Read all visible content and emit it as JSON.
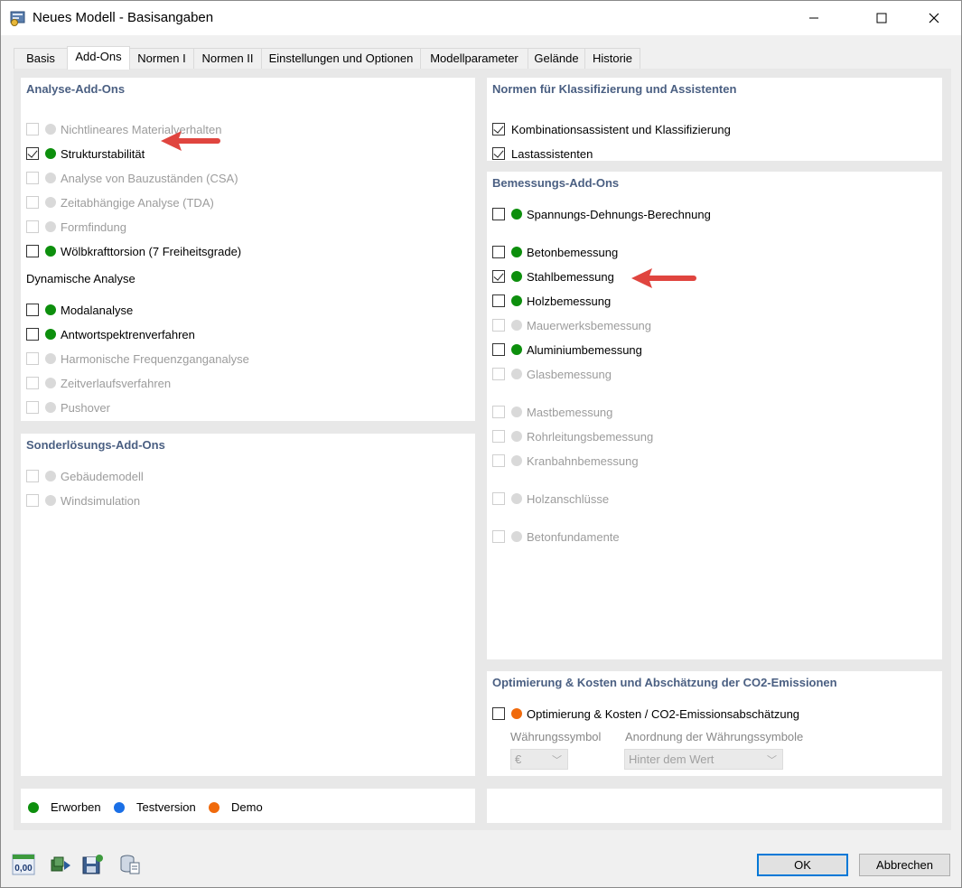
{
  "window": {
    "title": "Neues Modell - Basisangaben",
    "icons": [
      "app-icon",
      "minimize-icon",
      "maximize-icon",
      "close-icon"
    ]
  },
  "tabs": [
    {
      "label": "Basis"
    },
    {
      "label": "Add-Ons"
    },
    {
      "label": "Normen I"
    },
    {
      "label": "Normen II"
    },
    {
      "label": "Einstellungen und Optionen"
    },
    {
      "label": "Modellparameter"
    },
    {
      "label": "Gelände"
    },
    {
      "label": "Historie"
    }
  ],
  "active_tab": "Add-Ons",
  "analysis": {
    "title": "Analyse-Add-Ons",
    "items": [
      {
        "label": "Nichtlineares Materialverhalten",
        "checked": false,
        "enabled": false,
        "status": "none"
      },
      {
        "label": "Strukturstabilität",
        "checked": true,
        "enabled": true,
        "status": "erworben"
      },
      {
        "label": "Analyse von Bauzuständen (CSA)",
        "checked": false,
        "enabled": false,
        "status": "none"
      },
      {
        "label": "Zeitabhängige Analyse (TDA)",
        "checked": false,
        "enabled": false,
        "status": "none"
      },
      {
        "label": "Formfindung",
        "checked": false,
        "enabled": false,
        "status": "none"
      },
      {
        "label": "Wölbkrafttorsion (7 Freiheitsgrade)",
        "checked": false,
        "enabled": true,
        "status": "erworben"
      }
    ],
    "dynamic_label": "Dynamische Analyse",
    "dynamic_items": [
      {
        "label": "Modalanalyse",
        "checked": false,
        "enabled": true,
        "status": "erworben"
      },
      {
        "label": "Antwortspektrenverfahren",
        "checked": false,
        "enabled": true,
        "status": "erworben"
      },
      {
        "label": "Harmonische Frequenzganganalyse",
        "checked": false,
        "enabled": false,
        "status": "none"
      },
      {
        "label": "Zeitverlaufsverfahren",
        "checked": false,
        "enabled": false,
        "status": "none"
      },
      {
        "label": "Pushover",
        "checked": false,
        "enabled": false,
        "status": "none"
      }
    ]
  },
  "special": {
    "title": "Sonderlösungs-Add-Ons",
    "items": [
      {
        "label": "Gebäudemodell",
        "checked": false,
        "enabled": false,
        "status": "none"
      },
      {
        "label": "Windsimulation",
        "checked": false,
        "enabled": false,
        "status": "none"
      }
    ]
  },
  "standards": {
    "title": "Normen für Klassifizierung und Assistenten",
    "items": [
      {
        "label": "Kombinationsassistent und Klassifizierung",
        "checked": true,
        "enabled": true
      },
      {
        "label": "Lastassistenten",
        "checked": true,
        "enabled": true
      }
    ]
  },
  "design": {
    "title": "Bemessungs-Add-Ons",
    "items": [
      {
        "label": "Spannungs-Dehnungs-Berechnung",
        "checked": false,
        "enabled": true,
        "status": "erworben"
      },
      {
        "label": "Betonbemessung",
        "checked": false,
        "enabled": true,
        "status": "erworben"
      },
      {
        "label": "Stahlbemessung",
        "checked": true,
        "enabled": true,
        "status": "erworben"
      },
      {
        "label": "Holzbemessung",
        "checked": false,
        "enabled": true,
        "status": "erworben"
      },
      {
        "label": "Mauerwerksbemessung",
        "checked": false,
        "enabled": false,
        "status": "none"
      },
      {
        "label": "Aluminiumbemessung",
        "checked": false,
        "enabled": true,
        "status": "erworben"
      },
      {
        "label": "Glasbemessung",
        "checked": false,
        "enabled": false,
        "status": "none"
      },
      {
        "label": "Mastbemessung",
        "checked": false,
        "enabled": false,
        "status": "none"
      },
      {
        "label": "Rohrleitungsbemessung",
        "checked": false,
        "enabled": false,
        "status": "none"
      },
      {
        "label": "Kranbahnbemessung",
        "checked": false,
        "enabled": false,
        "status": "none"
      },
      {
        "label": "Holzanschlüsse",
        "checked": false,
        "enabled": false,
        "status": "none"
      },
      {
        "label": "Betonfundamente",
        "checked": false,
        "enabled": false,
        "status": "none"
      }
    ]
  },
  "optimization": {
    "title": "Optimierung & Kosten und Abschätzung der CO2-Emissionen",
    "item": {
      "label": "Optimierung & Kosten / CO2-Emissionsabschätzung",
      "checked": false,
      "enabled": true,
      "status": "demo"
    },
    "currency_label": "Währungssymbol",
    "currency_value": "€",
    "placement_label": "Anordnung der Währungssymbole",
    "placement_value": "Hinter dem Wert"
  },
  "legend": [
    {
      "label": "Erworben",
      "color": "#0d8f0d"
    },
    {
      "label": "Testversion",
      "color": "#1a6fe6"
    },
    {
      "label": "Demo",
      "color": "#f06a0c"
    }
  ],
  "toolbar": {
    "icons": [
      "units-icon",
      "model-transfer-icon",
      "save-defaults-icon",
      "database-icon"
    ],
    "units_text": "0,00"
  },
  "buttons": {
    "ok": "OK",
    "cancel": "Abbrechen"
  },
  "colors": {
    "accent": "#0078d7",
    "section_title": "#4a5f82",
    "annotation_arrow": "#e0453f"
  }
}
